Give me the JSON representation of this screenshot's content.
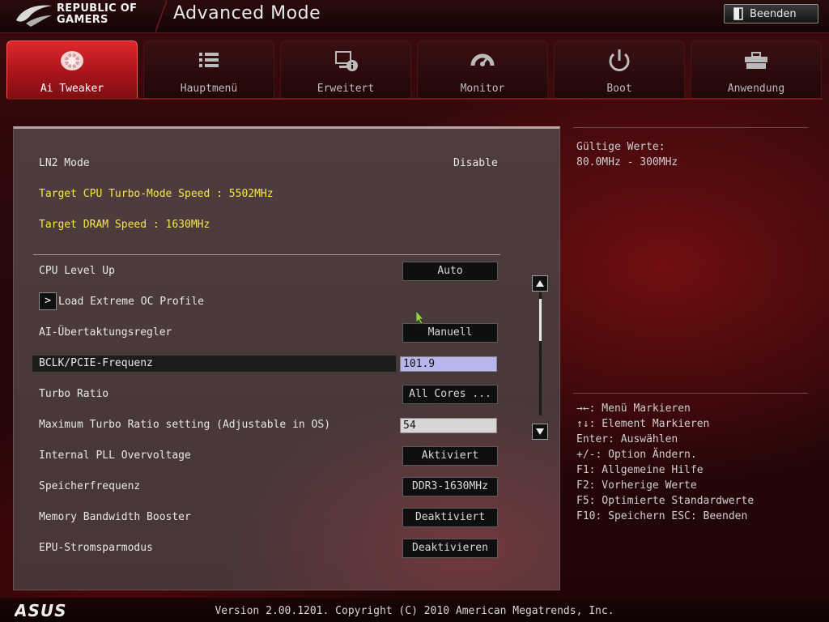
{
  "header": {
    "brand_line1": "REPUBLIC OF",
    "brand_line2": "GAMERS",
    "title": "Advanced Mode",
    "exit_label": "Beenden"
  },
  "tabs": [
    {
      "label": "Ai Tweaker",
      "icon": "ai-tweaker-icon",
      "active": true
    },
    {
      "label": "Hauptmenü",
      "icon": "list-icon",
      "active": false
    },
    {
      "label": "Erweitert",
      "icon": "advanced-info-icon",
      "active": false
    },
    {
      "label": "Monitor",
      "icon": "gauge-icon",
      "active": false
    },
    {
      "label": "Boot",
      "icon": "power-icon",
      "active": false
    },
    {
      "label": "Anwendung",
      "icon": "toolbox-icon",
      "active": false
    }
  ],
  "main": {
    "info": {
      "ln2_label": "LN2 Mode",
      "ln2_value": "Disable",
      "target_cpu": "Target CPU Turbo-Mode Speed : 5502MHz",
      "target_dram": "Target DRAM Speed : 1630MHz"
    },
    "settings": {
      "cpu_level_up": {
        "label": "CPU Level Up",
        "value": "Auto"
      },
      "load_profile": {
        "label": "Load Extreme OC Profile",
        "arrow": ">"
      },
      "ai_regler": {
        "label": "AI-Übertaktungsregler",
        "value": "Manuell"
      },
      "bclk": {
        "label": "BCLK/PCIE-Frequenz",
        "value": "101.9"
      },
      "turbo_ratio": {
        "label": "Turbo Ratio",
        "value": "All Cores ..."
      },
      "max_turbo": {
        "label": "Maximum Turbo Ratio setting (Adjustable in OS)",
        "value": "54"
      },
      "pll": {
        "label": "Internal PLL Overvoltage",
        "value": "Aktiviert"
      },
      "speicher": {
        "label": "Speicherfrequenz",
        "value": "DDR3-1630MHz"
      },
      "mem_boost": {
        "label": "Memory Bandwidth Booster",
        "value": "Deaktiviert"
      },
      "epu": {
        "label": "EPU-Stromsparmodus",
        "value": "Deaktivieren"
      }
    }
  },
  "help": {
    "valid_title": "Gültige Werte:",
    "valid_range": "80.0MHz - 300MHz",
    "keys": [
      "→←: Menü Markieren",
      "↑↓: Element Markieren",
      "Enter: Auswählen",
      "+/-: Option Ändern.",
      "F1: Allgemeine Hilfe",
      "F2: Vorherige Werte",
      "F5: Optimierte Standardwerte",
      "F10: Speichern  ESC: Beenden"
    ]
  },
  "footer": {
    "version": "Version 2.00.1201. Copyright (C) 2010 American Megatrends, Inc."
  },
  "colors": {
    "accent_red": "#c8181d",
    "highlight_yellow": "#f6e64a",
    "bclk_input_bg": "#b9b6ee",
    "turbo_input_bg": "#d6d6d6"
  }
}
